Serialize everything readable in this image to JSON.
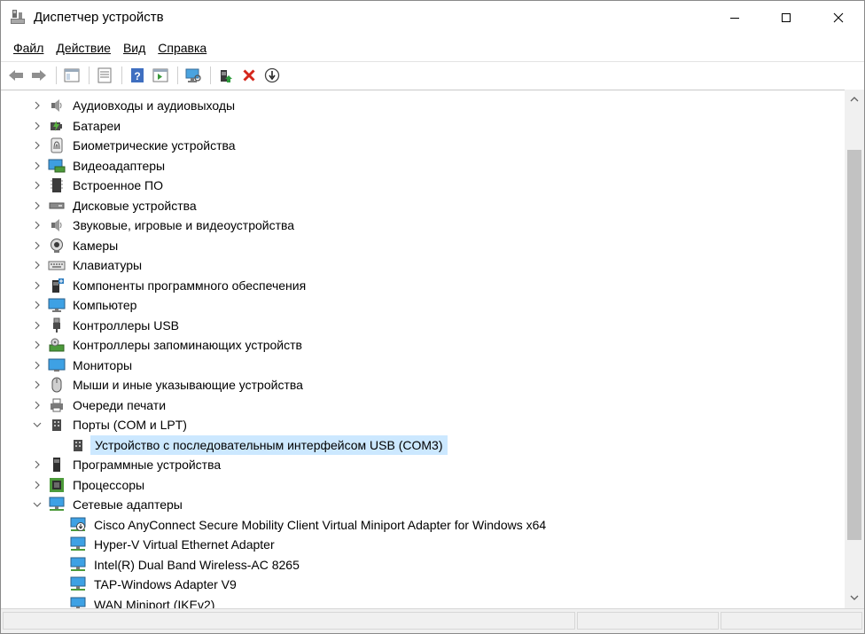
{
  "window": {
    "title": "Диспетчер устройств"
  },
  "menu": [
    {
      "label": "Файл"
    },
    {
      "label": "Действие"
    },
    {
      "label": "Вид"
    },
    {
      "label": "Справка"
    }
  ],
  "tree": {
    "categories": [
      {
        "label": "Аудиовходы и аудиовыходы",
        "icon": "speaker-icon",
        "expanded": false
      },
      {
        "label": "Батареи",
        "icon": "battery-icon",
        "expanded": false
      },
      {
        "label": "Биометрические устройства",
        "icon": "fingerprint-icon",
        "expanded": false
      },
      {
        "label": "Видеоадаптеры",
        "icon": "display-adapter-icon",
        "expanded": false
      },
      {
        "label": "Встроенное ПО",
        "icon": "firmware-chip-icon",
        "expanded": false
      },
      {
        "label": "Дисковые устройства",
        "icon": "disk-drive-icon",
        "expanded": false
      },
      {
        "label": "Звуковые, игровые и видеоустройства",
        "icon": "speaker-icon",
        "expanded": false
      },
      {
        "label": "Камеры",
        "icon": "webcam-icon",
        "expanded": false
      },
      {
        "label": "Клавиатуры",
        "icon": "keyboard-icon",
        "expanded": false
      },
      {
        "label": "Компоненты программного обеспечения",
        "icon": "software-component-icon",
        "expanded": false
      },
      {
        "label": "Компьютер",
        "icon": "computer-icon",
        "expanded": false
      },
      {
        "label": "Контроллеры USB",
        "icon": "usb-icon",
        "expanded": false
      },
      {
        "label": "Контроллеры запоминающих устройств",
        "icon": "storage-controller-icon",
        "expanded": false
      },
      {
        "label": "Мониторы",
        "icon": "monitor-icon",
        "expanded": false
      },
      {
        "label": "Мыши и иные указывающие устройства",
        "icon": "mouse-icon",
        "expanded": false
      },
      {
        "label": "Очереди печати",
        "icon": "printer-icon",
        "expanded": false
      },
      {
        "label": "Порты (COM и LPT)",
        "icon": "port-icon",
        "expanded": true,
        "children": [
          {
            "label": "Устройство с последовательным интерфейсом USB (COM3)",
            "icon": "port-icon",
            "selected": true
          }
        ]
      },
      {
        "label": "Программные устройства",
        "icon": "software-device-icon",
        "expanded": false
      },
      {
        "label": "Процессоры",
        "icon": "processor-icon",
        "expanded": false
      },
      {
        "label": "Сетевые адаптеры",
        "icon": "network-adapter-icon",
        "expanded": true,
        "children": [
          {
            "label": "Cisco AnyConnect Secure Mobility Client Virtual Miniport Adapter for Windows x64",
            "icon": "network-adapter-disabled-icon"
          },
          {
            "label": "Hyper-V Virtual Ethernet Adapter",
            "icon": "network-adapter-icon"
          },
          {
            "label": "Intel(R) Dual Band Wireless-AC 8265",
            "icon": "network-adapter-icon"
          },
          {
            "label": "TAP-Windows Adapter V9",
            "icon": "network-adapter-icon"
          },
          {
            "label": "WAN Miniport (IKEv2)",
            "icon": "network-adapter-icon"
          }
        ]
      }
    ]
  }
}
